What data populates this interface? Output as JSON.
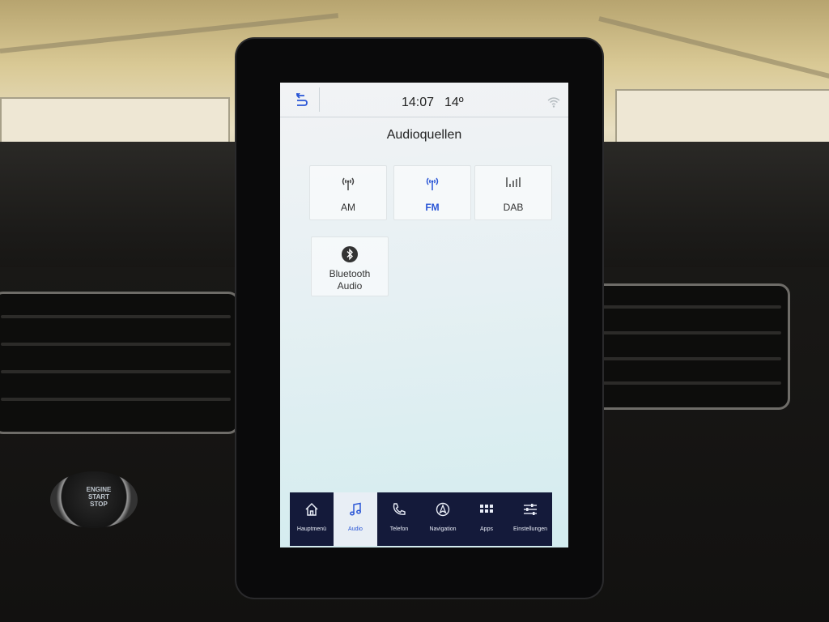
{
  "status": {
    "time": "14:07",
    "temperature": "14º"
  },
  "title": "Audioquellen",
  "sources": [
    {
      "id": "am",
      "label": "AM",
      "icon": "antenna-icon",
      "active": false
    },
    {
      "id": "fm",
      "label": "FM",
      "icon": "antenna-icon",
      "active": true
    },
    {
      "id": "dab",
      "label": "DAB",
      "icon": "dab-signal-icon",
      "active": false
    },
    {
      "id": "bt",
      "label_line1": "Bluetooth",
      "label_line2": "Audio",
      "icon": "bluetooth-icon",
      "active": false
    }
  ],
  "nav": [
    {
      "label": "Hauptmenü",
      "icon": "home-icon"
    },
    {
      "label": "Audio",
      "icon": "music-note-icon",
      "active": true
    },
    {
      "label": "Telefon",
      "icon": "phone-icon"
    },
    {
      "label": "Navigation",
      "icon": "navigation-icon"
    },
    {
      "label": "Apps",
      "icon": "apps-grid-icon"
    },
    {
      "label": "Einstellungen",
      "icon": "settings-sliders-icon"
    }
  ],
  "engine_button": {
    "line1": "ENGINE",
    "line2": "START",
    "line3": "STOP"
  },
  "colors": {
    "accent": "#2a56d6",
    "navbar": "#141a3a"
  }
}
